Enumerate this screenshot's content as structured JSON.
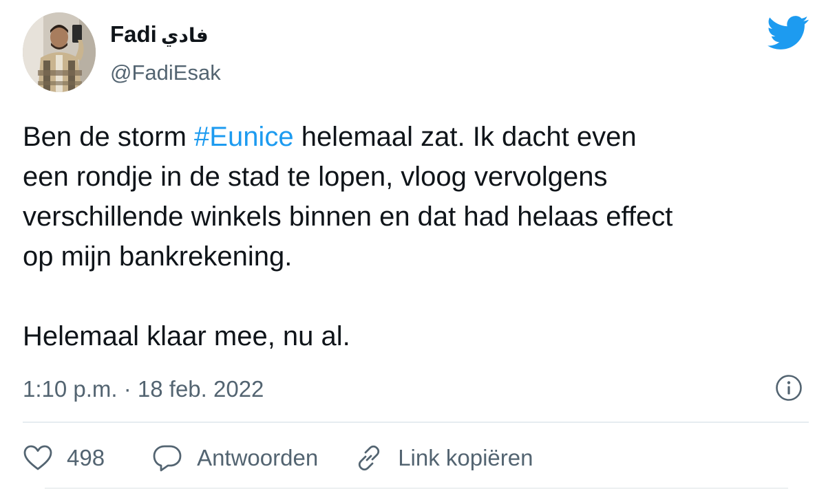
{
  "user": {
    "display_name": "Fadi",
    "display_name_arabic": "فادي",
    "handle": "@FadiEsak"
  },
  "tweet": {
    "line1_before": "Ben de storm ",
    "hashtag": "#Eunice",
    "line1_after": " helemaal zat. Ik dacht even",
    "line2": "een rondje in de stad te lopen, vloog vervolgens",
    "line3": "verschillende winkels binnen en dat had helaas effect",
    "line4": "op mijn bankrekening.",
    "paragraph2": "Helemaal klaar mee, nu al.",
    "timestamp": "1:10 p.m. · 18 feb. 2022"
  },
  "actions": {
    "like_count": "498",
    "reply_label": "Antwoorden",
    "copy_link_label": "Link kopiëren"
  },
  "icons": {
    "brand": "twitter-bird-icon",
    "info": "info-icon",
    "like": "heart-icon",
    "reply": "speech-bubble-icon",
    "copy_link": "link-icon"
  },
  "colors": {
    "twitter_blue": "#1d9bf0",
    "text_primary": "#0f1419",
    "text_secondary": "#536471",
    "divider": "#e6ecf0"
  }
}
